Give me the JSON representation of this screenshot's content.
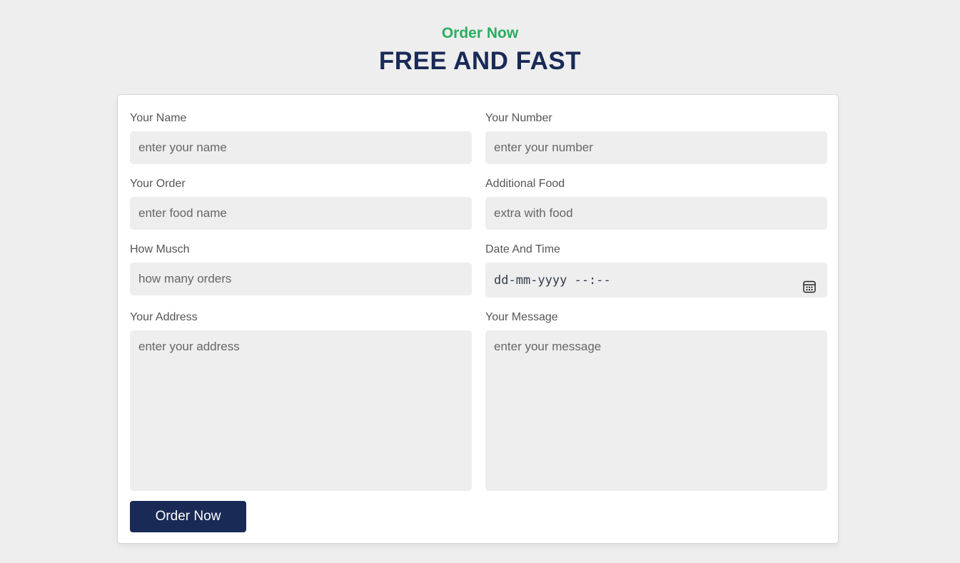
{
  "header": {
    "sub_heading": "Order Now",
    "main_heading": "FREE AND FAST"
  },
  "form": {
    "name": {
      "label": "Your Name",
      "placeholder": "enter your name"
    },
    "number": {
      "label": "Your Number",
      "placeholder": "enter your number"
    },
    "order": {
      "label": "Your Order",
      "placeholder": "enter food name"
    },
    "additional": {
      "label": "Additional Food",
      "placeholder": "extra with food"
    },
    "quantity": {
      "label": "How Musch",
      "placeholder": "how many orders"
    },
    "datetime": {
      "label": "Date And Time",
      "value": "dd-mm-yyyy --:--",
      "icon": "calendar-icon"
    },
    "address": {
      "label": "Your Address",
      "placeholder": "enter your address"
    },
    "message": {
      "label": "Your Message",
      "placeholder": "enter your message"
    },
    "submit_label": "Order Now"
  },
  "colors": {
    "accent_green": "#27ae60",
    "brand_navy": "#192a56",
    "page_background": "#eeeeee",
    "input_background": "#eeeeee"
  }
}
